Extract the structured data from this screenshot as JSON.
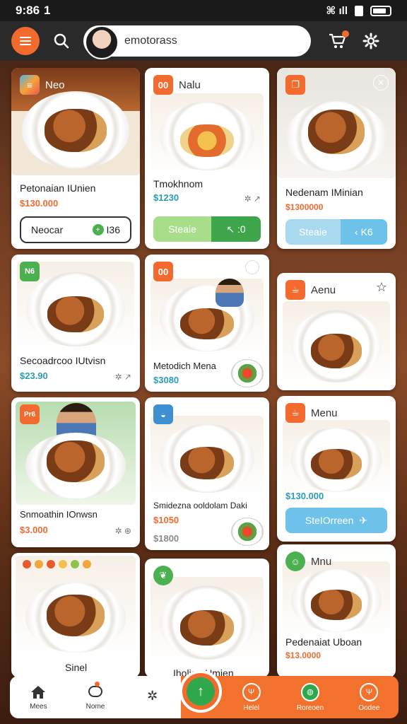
{
  "status_bar": {
    "time": "9:86",
    "carrier_mark": "1",
    "signal": "⌘ ıll"
  },
  "top_bar": {
    "search_value": "emotorass",
    "icons": [
      "menu-icon",
      "search-icon",
      "cart-icon",
      "gear-icon"
    ]
  },
  "cards": {
    "c1": {
      "badge_label": "Neo",
      "title": "Petonaian IUnien",
      "price": "$130.000",
      "button_label": "Neocar",
      "button_chip": "I36"
    },
    "c2": {
      "badge_text": "00",
      "badge_label": "Nalu",
      "title": "Tmokhnom",
      "price": "$1230",
      "button_left": "Steaie",
      "button_right": "↖ :0"
    },
    "c3": {
      "title": "Nedenam IMinian",
      "price": "$1300000",
      "button_left": "Steaie",
      "button_right": "‹ K6"
    },
    "c4": {
      "badge_text": "N6",
      "title": "Secoadrcoo IUtvisn",
      "price": "$23.90"
    },
    "c5": {
      "badge_text": "00",
      "title": "Metodich Mena",
      "price": "$3080"
    },
    "c6": {
      "badge_label": "Aenu",
      "title": "",
      "price": ""
    },
    "c7": {
      "badge_text": "Pr6",
      "title": "Snmoathin IOnwsn",
      "price": "$3.000"
    },
    "c8": {
      "title": "Smidezna ooldolam Daki",
      "price1": "$1050",
      "price2": "$1800"
    },
    "c9": {
      "badge_label": "Menu",
      "price": "$130.000",
      "button_label": "SteIOrreen"
    },
    "c10": {
      "title": "Sinel"
    },
    "c11": {
      "title": "Iholian Umien"
    },
    "c12": {
      "badge_label": "Mnu",
      "title": "Pedenaiat Uboan",
      "price": "$13.0000"
    }
  },
  "bottom_nav": {
    "items": [
      "Mees",
      "Nome",
      "",
      "Helel",
      "Roreoen",
      "Oodee"
    ]
  },
  "colors": {
    "accent": "#f26a2e",
    "green": "#2ea84b",
    "teal": "#2a9db8",
    "blue": "#6ec2ea"
  }
}
